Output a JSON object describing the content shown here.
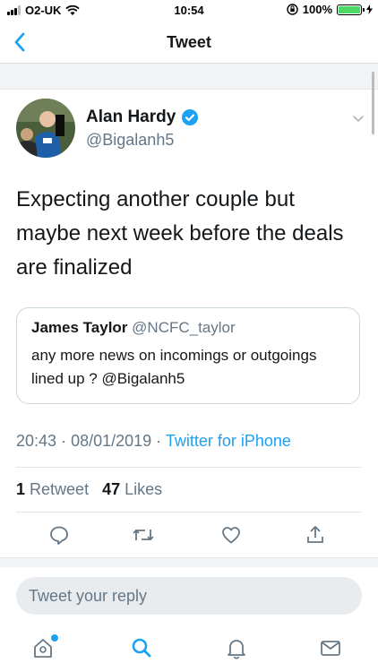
{
  "status": {
    "carrier": "O2-UK",
    "time": "10:54",
    "battery": "100%",
    "battery_level": 1.0
  },
  "nav": {
    "title": "Tweet",
    "back_icon": "chevron-left-icon"
  },
  "tweet": {
    "author_name": "Alan Hardy",
    "author_handle": "@Bigalanh5",
    "text": "Expecting another couple but maybe next week before the deals are finalized",
    "quoted": {
      "name": "James Taylor",
      "handle": "@NCFC_taylor",
      "text": "any more news on incomings or outgoings lined up ? @Bigalanh5"
    },
    "time": "20:43",
    "date": "08/01/2019",
    "source": "Twitter for iPhone",
    "retweet_count": "1",
    "retweet_label": "Retweet",
    "like_count": "47",
    "like_label": "Likes"
  },
  "reply": {
    "placeholder": "Tweet your reply"
  },
  "colors": {
    "accent": "#1da1f2",
    "secondary_text": "#657786",
    "verified": "#1da1f2"
  },
  "icons": {
    "actions": [
      "comment-icon",
      "retweet-icon",
      "like-icon",
      "share-icon"
    ],
    "tabs": [
      "home-icon",
      "search-icon",
      "notifications-icon",
      "messages-icon"
    ]
  }
}
